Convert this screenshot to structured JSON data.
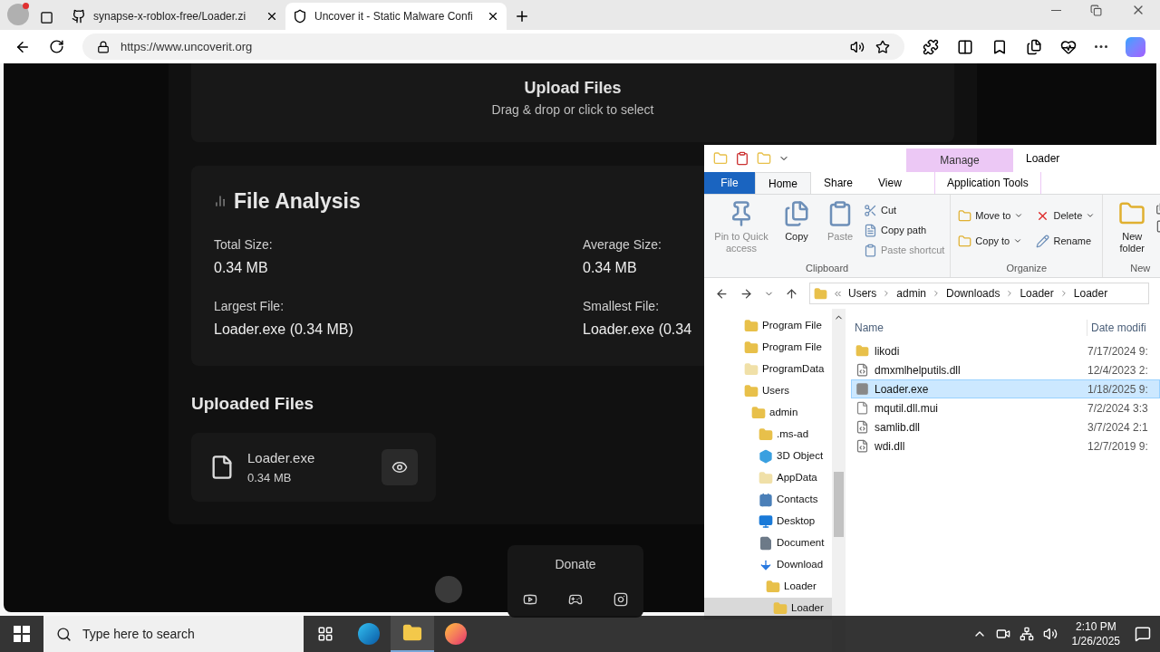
{
  "browser": {
    "tabs": [
      {
        "title": "synapse-x-roblox-free/Loader.zi",
        "kind": "github",
        "selected": false
      },
      {
        "title": "Uncover it - Static Malware Confi",
        "kind": "site",
        "selected": true
      }
    ],
    "url": "https://www.uncoverit.org"
  },
  "page": {
    "upload": {
      "title": "Upload Files",
      "hint": "Drag & drop or click to select"
    },
    "analysis": {
      "title": "File Analysis",
      "stats": [
        {
          "label": "Total Size:",
          "value": "0.34 MB"
        },
        {
          "label": "Average Size:",
          "value": "0.34 MB"
        },
        {
          "label": "Largest File:",
          "value": "Loader.exe (0.34 MB)"
        },
        {
          "label": "Smallest File:",
          "value": "Loader.exe (0.34"
        }
      ]
    },
    "uploaded": {
      "title": "Uploaded Files",
      "files": [
        {
          "name": "Loader.exe",
          "size": "0.34 MB"
        }
      ]
    },
    "footer": {
      "donate": "Donate"
    }
  },
  "explorer": {
    "context_tab": "Manage",
    "title": "Loader",
    "tabs": [
      {
        "label": "File",
        "kind": "file",
        "selected": false
      },
      {
        "label": "Home",
        "kind": "tab",
        "selected": true
      },
      {
        "label": "Share",
        "kind": "tab",
        "selected": false
      },
      {
        "label": "View",
        "kind": "tab",
        "selected": false
      },
      {
        "label": "Application Tools",
        "kind": "context",
        "selected": false
      }
    ],
    "groups": [
      {
        "label": "Clipboard",
        "items": [
          {
            "label": "Pin to Quick access",
            "kind": "pin",
            "disabled": true
          },
          {
            "label": "Copy",
            "kind": "copy",
            "disabled": false
          },
          {
            "label": "Paste",
            "kind": "paste",
            "disabled": true
          },
          {
            "label": "Cut",
            "kind": "cut",
            "disabled": false
          },
          {
            "label": "Copy path",
            "kind": "copypath",
            "disabled": false
          },
          {
            "label": "Paste shortcut",
            "kind": "pasteshortcut",
            "disabled": true
          }
        ]
      },
      {
        "label": "Organize",
        "items": [
          {
            "label": "Move to",
            "kind": "moveto",
            "disabled": false
          },
          {
            "label": "Copy to",
            "kind": "copyto",
            "disabled": false
          },
          {
            "label": "Delete",
            "kind": "delete",
            "disabled": false
          },
          {
            "label": "Rename",
            "kind": "rename",
            "disabled": false
          }
        ]
      },
      {
        "label": "New",
        "items": [
          {
            "label": "New folder",
            "kind": "newfolder",
            "disabled": false
          }
        ]
      }
    ],
    "breadcrumb": [
      "Users",
      "admin",
      "Downloads",
      "Loader",
      "Loader"
    ],
    "tree": [
      {
        "label": "Program File",
        "kind": "folder",
        "selected": false
      },
      {
        "label": "Program File",
        "kind": "folder",
        "selected": false
      },
      {
        "label": "ProgramData",
        "kind": "hidden",
        "selected": false
      },
      {
        "label": "Users",
        "kind": "folder",
        "selected": false,
        "children": [
          {
            "label": "admin",
            "kind": "folder",
            "selected": false,
            "children": [
              {
                "label": ".ms-ad",
                "kind": "folder",
                "selected": false
              },
              {
                "label": "3D Object",
                "kind": "objects",
                "selected": false
              },
              {
                "label": "AppData",
                "kind": "hidden",
                "selected": false
              },
              {
                "label": "Contacts",
                "kind": "contacts",
                "selected": false
              },
              {
                "label": "Desktop",
                "kind": "desktop",
                "selected": false
              },
              {
                "label": "Document",
                "kind": "documents",
                "selected": false
              },
              {
                "label": "Download",
                "kind": "downloads",
                "selected": false,
                "children": [
                  {
                    "label": "Loader",
                    "kind": "folder",
                    "selected": false,
                    "children": [
                      {
                        "label": "Loader",
                        "kind": "folder",
                        "selected": true
                      }
                    ]
                  }
                ]
              }
            ]
          }
        ]
      }
    ],
    "columns": [
      "Name",
      "Date modifi"
    ],
    "files": [
      {
        "name": "likodi",
        "date": "7/17/2024 9:",
        "kind": "folder",
        "selected": false
      },
      {
        "name": "dmxmlhelputils.dll",
        "date": "12/4/2023 2:",
        "kind": "dll",
        "selected": false
      },
      {
        "name": "Loader.exe",
        "date": "1/18/2025 9:",
        "kind": "exe",
        "selected": true
      },
      {
        "name": "mqutil.dll.mui",
        "date": "7/2/2024 3:3",
        "kind": "file",
        "selected": false
      },
      {
        "name": "samlib.dll",
        "date": "3/7/2024 2:1",
        "kind": "dll",
        "selected": false
      },
      {
        "name": "wdi.dll",
        "date": "12/7/2019 9:",
        "kind": "dll",
        "selected": false
      }
    ]
  },
  "taskbar": {
    "search": "Type here to search",
    "apps": [
      {
        "kind": "taskview",
        "selected": false
      },
      {
        "kind": "edge",
        "selected": false
      },
      {
        "kind": "explorer",
        "selected": true
      },
      {
        "kind": "firefox",
        "selected": false
      }
    ],
    "time": "2:10 PM",
    "date": "1/26/2025"
  }
}
